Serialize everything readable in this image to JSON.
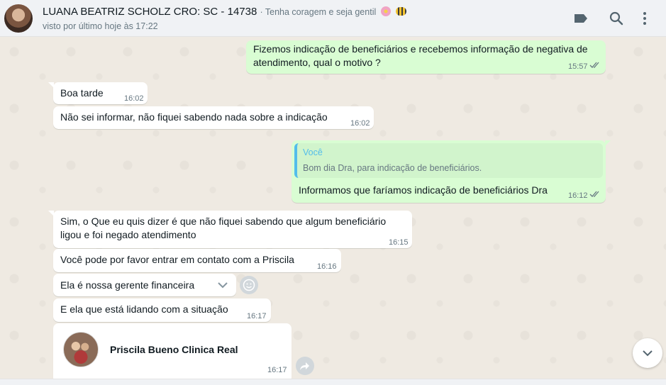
{
  "header": {
    "contact_name": "LUANA BEATRIZ SCHOLZ CRO: SC - 14738",
    "status_text": "· Tenha coragem e seja gentil",
    "last_seen": "visto por último hoje às 17:22",
    "icons": [
      "avatar",
      "label-icon",
      "search-icon",
      "menu-dots-icon"
    ]
  },
  "messages": [
    {
      "id": "m1",
      "direction": "out",
      "lines": [
        "Fizemos indicação de beneficiários e recebemos informação de negativa de",
        "atendimento, qual o motivo ?"
      ],
      "time": "15:57",
      "status": "read"
    },
    {
      "id": "m2",
      "direction": "in",
      "lines": [
        "Boa tarde"
      ],
      "time": "16:02"
    },
    {
      "id": "m3",
      "direction": "in",
      "lines": [
        "Não sei informar, não fiquei sabendo nada sobre a indicação"
      ],
      "time": "16:02"
    },
    {
      "id": "m4",
      "direction": "out",
      "quote": {
        "author": "Você",
        "text": "Bom dia Dra, para indicação de beneficiários."
      },
      "lines": [
        "Informamos que faríamos indicação de beneficiários Dra"
      ],
      "time": "16:12",
      "status": "read"
    },
    {
      "id": "m5",
      "direction": "in",
      "lines": [
        "Sim, o Que eu quis dizer é que não fiquei sabendo que algum beneficiário",
        "ligou e foi negado atendimento"
      ],
      "time": "16:15"
    },
    {
      "id": "m6",
      "direction": "in",
      "lines": [
        "Você pode por favor entrar em contato com a Priscila"
      ],
      "time": "16:16"
    },
    {
      "id": "m7",
      "direction": "in",
      "lines": [
        "Ela é nossa gerente financeira"
      ],
      "time": ""
    },
    {
      "id": "m8",
      "direction": "in",
      "lines": [
        "E ela que está lidando com a situação"
      ],
      "time": "16:17"
    },
    {
      "id": "m9",
      "direction": "in",
      "type": "contact",
      "contact_name": "Priscila Bueno Clinica Real",
      "time": "16:17"
    }
  ]
}
